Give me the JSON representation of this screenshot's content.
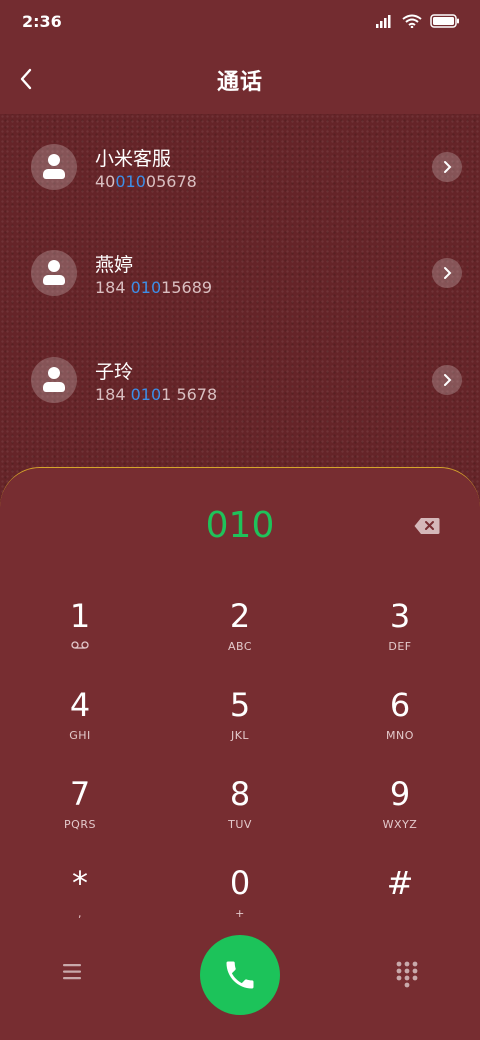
{
  "status": {
    "time": "2:36"
  },
  "header": {
    "title": "通话"
  },
  "contacts": [
    {
      "name": "小米客服",
      "num_pre": "40",
      "num_hl": "010",
      "num_post": "05678"
    },
    {
      "name": "燕婷",
      "num_pre": "184 ",
      "num_hl": "010",
      "num_post": "15689"
    },
    {
      "name": "子玲",
      "num_pre": "184 ",
      "num_hl": "010",
      "num_post": "1 5678"
    }
  ],
  "dialer": {
    "input": "010",
    "keys": [
      {
        "digit": "1",
        "letters": ""
      },
      {
        "digit": "2",
        "letters": "ABC"
      },
      {
        "digit": "3",
        "letters": "DEF"
      },
      {
        "digit": "4",
        "letters": "GHI"
      },
      {
        "digit": "5",
        "letters": "JKL"
      },
      {
        "digit": "6",
        "letters": "MNO"
      },
      {
        "digit": "7",
        "letters": "PQRS"
      },
      {
        "digit": "8",
        "letters": "TUV"
      },
      {
        "digit": "9",
        "letters": "WXYZ"
      },
      {
        "digit": "*",
        "letters": ","
      },
      {
        "digit": "0",
        "letters": "+"
      },
      {
        "digit": "#",
        "letters": ""
      }
    ]
  },
  "colors": {
    "background": "#732c30",
    "accent_green": "#1fc25a",
    "highlight_blue": "#3d8fe8",
    "border_gold": "#d6a52b"
  },
  "icons": [
    "back-arrow-icon",
    "signal-icon",
    "wifi-icon",
    "battery-icon",
    "person-icon",
    "chevron-right-icon",
    "backspace-icon",
    "voicemail-icon",
    "menu-icon",
    "phone-icon",
    "keypad-icon"
  ]
}
